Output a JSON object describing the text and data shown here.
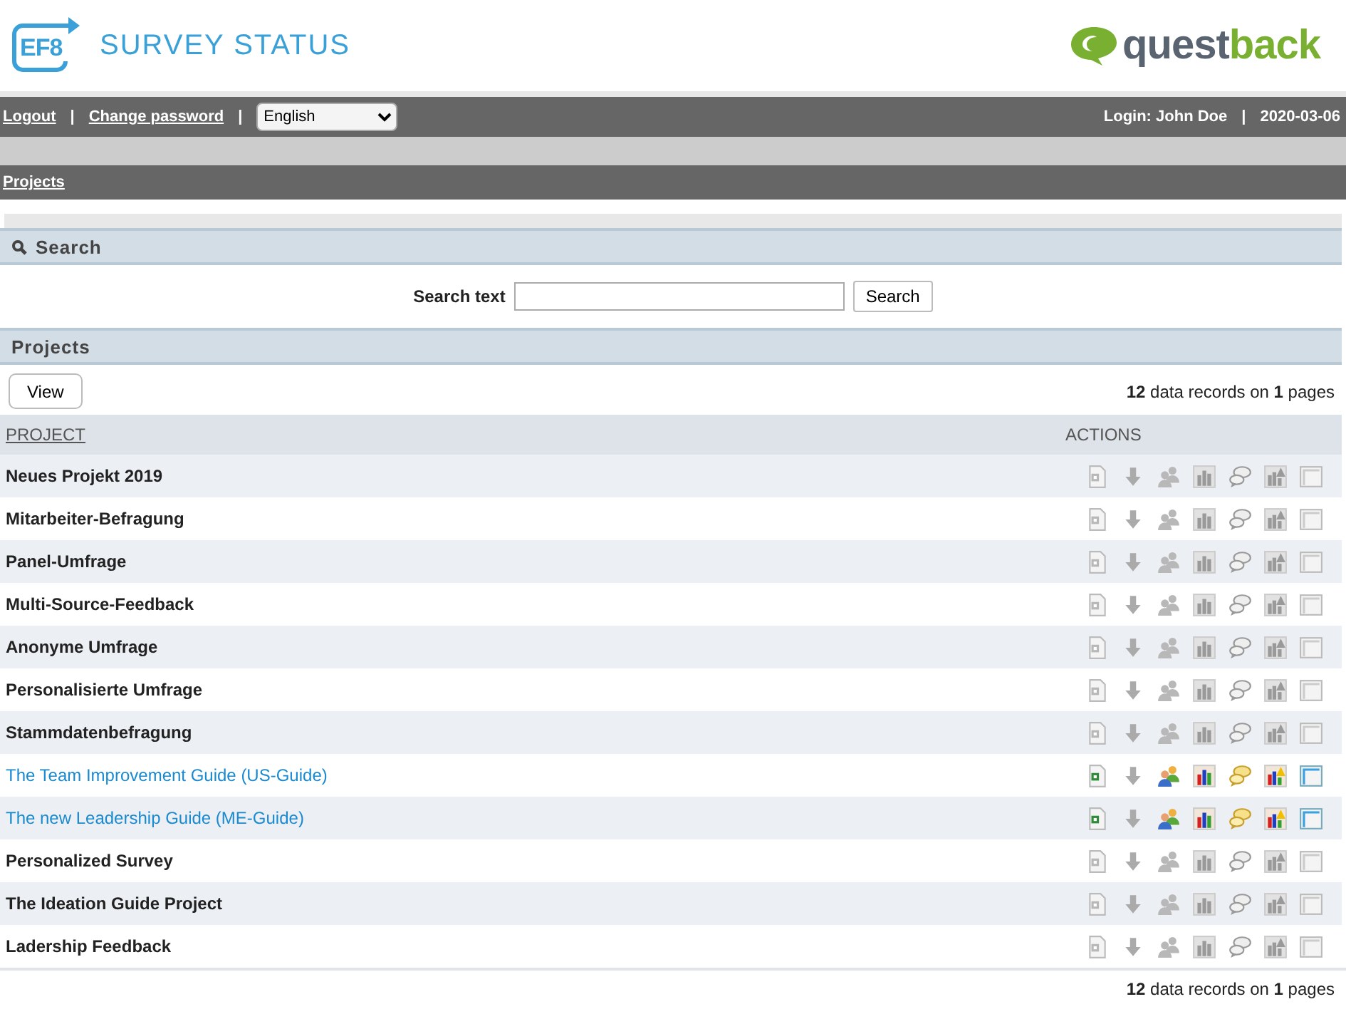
{
  "header": {
    "logo_badge": "EF8",
    "logo_title": "SURVEY STATUS",
    "brand": [
      "quest",
      "back"
    ]
  },
  "topbar": {
    "separator": "|",
    "links": [
      "Logout",
      "Change password"
    ],
    "language": "English",
    "login": "Login: John Doe",
    "date": "2020-03-06"
  },
  "breadcrumb": "Projects",
  "search": {
    "title": "Search",
    "label": "Search text",
    "button": "Search"
  },
  "projects": {
    "title": "Projects",
    "view_button": "View",
    "records_top": "**12** data records on **1** pages",
    "records_bottom": "**12** data records on **1** pages",
    "columns": [
      "PROJECT",
      "ACTIONS"
    ],
    "rows": [
      {
        "name": "Neues Projekt 2019",
        "active": false
      },
      {
        "name": "Mitarbeiter-Befragung",
        "active": false
      },
      {
        "name": "Panel-Umfrage",
        "active": false
      },
      {
        "name": "Multi-Source-Feedback",
        "active": false
      },
      {
        "name": "Anonyme Umfrage",
        "active": false
      },
      {
        "name": "Personalisierte Umfrage",
        "active": false
      },
      {
        "name": "Stammdatenbefragung",
        "active": false
      },
      {
        "name": "The Team Improvement Guide (US-Guide)",
        "active": true
      },
      {
        "name": "The new Leadership Guide (ME-Guide)",
        "active": true
      },
      {
        "name": "Personalized Survey",
        "active": false
      },
      {
        "name": "The Ideation Guide Project",
        "active": false
      },
      {
        "name": "Ladership Feedback",
        "active": false
      }
    ]
  }
}
